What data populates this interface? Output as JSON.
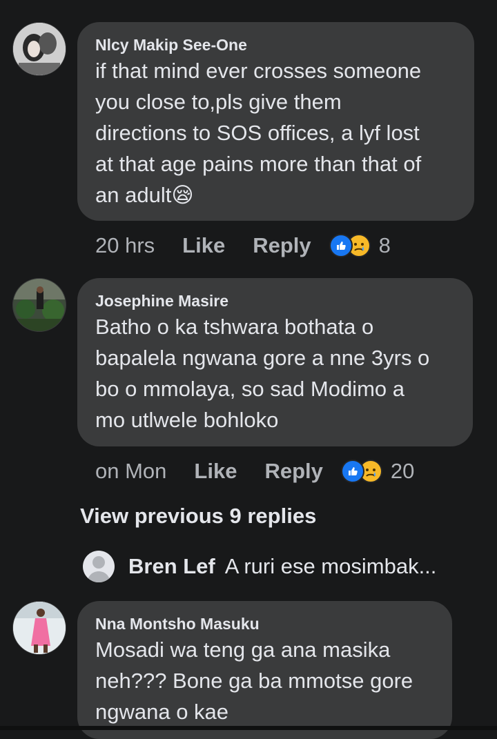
{
  "comments": [
    {
      "author": "Nlcy Makip See-One",
      "text": "if that mind ever crosses someone\nyou close to,pls give them\ndirections to SOS offices, a lyf lost\nat that age pains more than that of\nan adult",
      "emoji": "😪",
      "time": "20 hrs",
      "like_label": "Like",
      "reply_label": "Reply",
      "reaction_count": "8"
    },
    {
      "author": "Josephine Masire",
      "text": "Batho o ka tshwara bothata o\nbapalela ngwana gore a nne 3yrs o\nbo o mmolaya, so sad Modimo a\nmo utlwele bohloko",
      "time": "on Mon",
      "like_label": "Like",
      "reply_label": "Reply",
      "reaction_count": "20"
    },
    {
      "author": "Nna Montsho Masuku",
      "text": "Mosadi wa teng ga ana masika\nneh??? Bone ga ba mmotse gore\nngwana o kae"
    }
  ],
  "view_previous": "View previous 9 replies",
  "latest_reply": {
    "author": "Bren Lef",
    "preview": "A ruri ese mosimbak..."
  },
  "colors": {
    "background": "#18191a",
    "bubble": "#3a3b3c",
    "like_blue": "#1877f2",
    "sad_yellow": "#f7b928"
  }
}
